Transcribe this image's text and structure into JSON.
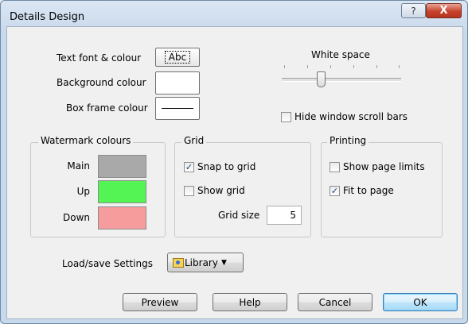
{
  "window": {
    "title": "Details Design",
    "help_glyph": "?",
    "close_glyph": "X"
  },
  "appearance": {
    "text_font_label": "Text font & colour",
    "text_font_sample": "Abc",
    "background_label": "Background colour",
    "frame_label": "Box frame colour"
  },
  "white_space": {
    "label": "White space",
    "level": 0.33
  },
  "hide_scrollbars": {
    "label": "Hide window scroll bars",
    "checked": false
  },
  "watermark": {
    "title": "Watermark colours",
    "main_label": "Main",
    "up_label": "Up",
    "down_label": "Down",
    "colors": {
      "main": "#a9a9a9",
      "up": "#54f454",
      "down": "#f79c9c"
    }
  },
  "grid": {
    "title": "Grid",
    "snap_label": "Snap to grid",
    "snap_checked": true,
    "show_label": "Show grid",
    "show_checked": false,
    "size_label": "Grid size",
    "size_value": "5"
  },
  "printing": {
    "title": "Printing",
    "page_limits_label": "Show page limits",
    "page_limits_checked": false,
    "fit_label": "Fit to page",
    "fit_checked": true
  },
  "settings": {
    "label": "Load/save Settings",
    "library_button": "Library"
  },
  "buttons": {
    "preview": "Preview",
    "help": "Help",
    "cancel": "Cancel",
    "ok": "OK"
  },
  "check_glyph": "✓"
}
